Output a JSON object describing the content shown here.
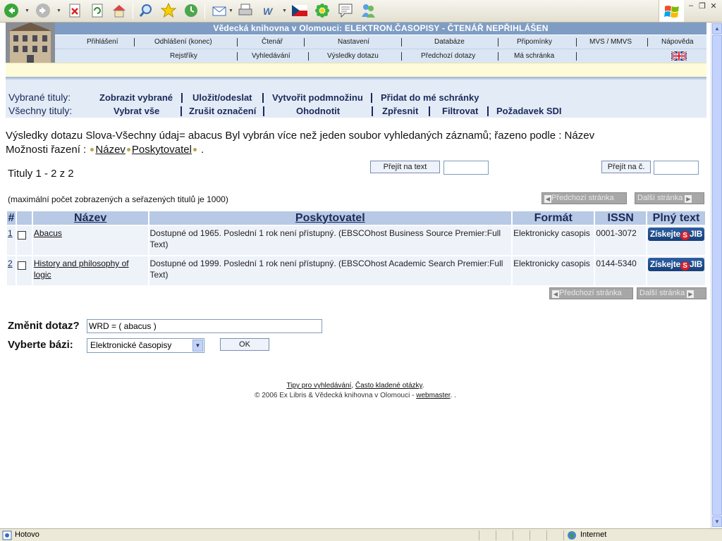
{
  "browser": {
    "status": "Hotovo",
    "zone": "Internet"
  },
  "header": {
    "title": "Vědecká knihovna v Olomouci: ELEKTRON.ČASOPISY - ČTENÁŘ NEPŘIHLÁŠEN",
    "nav1": [
      "Přihlášení",
      "Odhlášení (konec)",
      "Čtenář",
      "Nastavení",
      "Databáze",
      "Připomínky",
      "MVS / MMVS",
      "Nápověda"
    ],
    "nav2": [
      "Rejstříky",
      "Vyhledávání",
      "Výsledky dotazu",
      "Předchozí dotazy",
      "Má schránka"
    ]
  },
  "selection": {
    "selected_label": "Vybrané tituly:",
    "selected_links": [
      "Zobrazit vybrané",
      "Uložit/odeslat",
      "Vytvořit podmnožinu",
      "Přidat do mé schránky"
    ],
    "all_label": "Všechny tituly:",
    "all_links": [
      "Vybrat vše",
      "Zrušit označení",
      "Ohodnotit",
      "Zpřesnit",
      "Filtrovat",
      "Požadavek SDI"
    ]
  },
  "results": {
    "heading": "Výsledky dotazu Slova-Všechny údaj= abacus Byl vybrán více než jeden soubor vyhledaných záznamů; řazeno podle : Název",
    "sort_label": "Možnosti řazení :",
    "sort_title": "Název",
    "sort_provider": "Poskytovatel",
    "sort_end": ".",
    "count": "Tituly 1 - 2 z 2",
    "goto_text_btn": "Přejít na text",
    "goto_num_btn": "Přejít na č.",
    "max_note": "(maximální počet zobrazených a seřazených titulů je 1000)",
    "prev_page": "Předchozí stránka",
    "next_page": "Další stránka",
    "columns": [
      "#",
      "",
      "Název",
      "Poskytovatel",
      "Formát",
      "ISSN",
      "Plný text"
    ],
    "rows": [
      {
        "num": "1",
        "title": "Abacus",
        "provider": "Dostupné od 1965. Poslední 1 rok není přístupný. (EBSCOhost Business Source Premier:Full Text)",
        "format": "Elektronicky casopis",
        "issn": "0001-3072",
        "fulltext": "Získejte",
        "jib": "JIB"
      },
      {
        "num": "2",
        "title": "History and philosophy of logic",
        "provider": "Dostupné od 1999. Poslední 1 rok není přístupný. (EBSCOhost Academic Search Premier:Full Text)",
        "format": "Elektronicky casopis",
        "issn": "0144-5340",
        "fulltext": "Získejte",
        "jib": "JIB"
      }
    ]
  },
  "form": {
    "change_label": "Změnit dotaz?",
    "query_value": "WRD = ( abacus )",
    "base_label": "Vyberte bázi:",
    "base_value": "Elektronické časopisy",
    "ok": "OK"
  },
  "footer": {
    "tips": "Tipy pro vyhledávání",
    "faq": "Často kladené otázky",
    "copyright": "© 2006 Ex Libris & Vědecká knihovna v Olomouci - ",
    "webmaster": "webmaster",
    "end": ". ."
  },
  "colors": {
    "banner": "#7f9dc4",
    "nav": "#dbe6f4",
    "table_header": "#b7c9e4",
    "row": "#eef2f9",
    "jib": "#163f78"
  }
}
